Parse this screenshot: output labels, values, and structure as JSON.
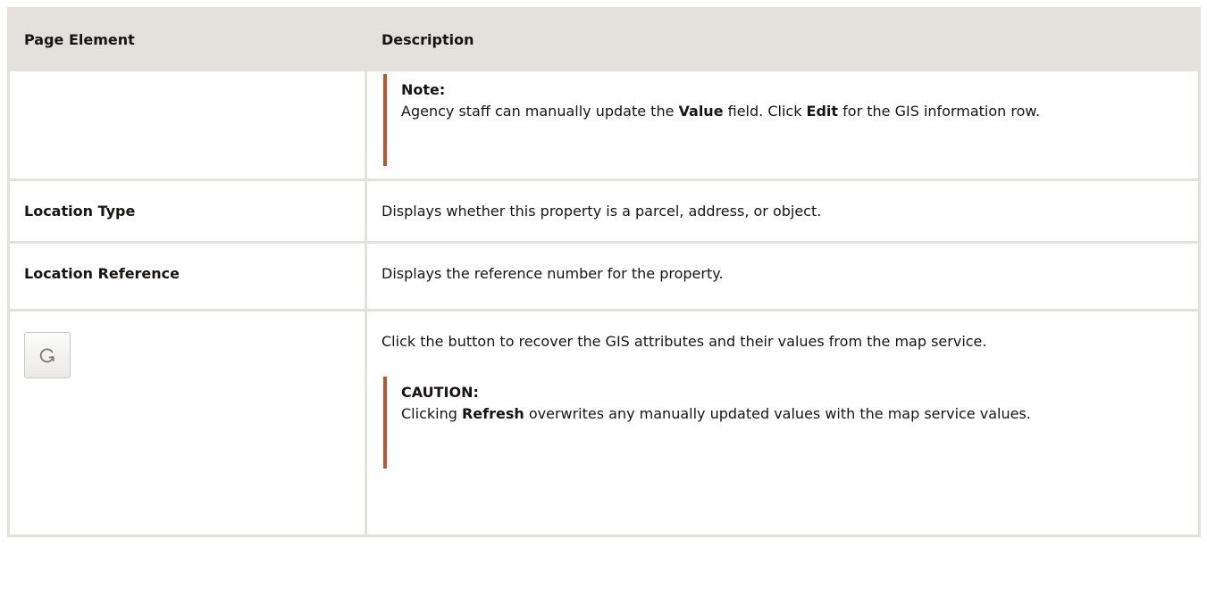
{
  "table": {
    "headers": {
      "element": "Page Element",
      "description": "Description"
    },
    "note": {
      "title": "Note:",
      "text_1": "Agency staff can manually update the ",
      "bold_1": "Value",
      "text_2": " field. Click ",
      "bold_2": "Edit",
      "text_3": " for the GIS information row."
    },
    "rows": [
      {
        "element": "Location Type",
        "description": "Displays whether this property is a parcel, address, or object."
      },
      {
        "element": "Location Reference",
        "description": "Displays the reference number for the property."
      }
    ],
    "refresh_row": {
      "button_icon": "refresh-icon",
      "description": "Click the button to recover the GIS attributes and their values from the map service.",
      "caution": {
        "title": "CAUTION:",
        "text_1": "Clicking ",
        "bold_1": "Refresh",
        "text_2": " overwrites any manually updated values with the map service values."
      }
    }
  },
  "colors": {
    "header_bg": "#e4e1dc",
    "callout_bar": "#c0532b",
    "text": "#161513"
  }
}
